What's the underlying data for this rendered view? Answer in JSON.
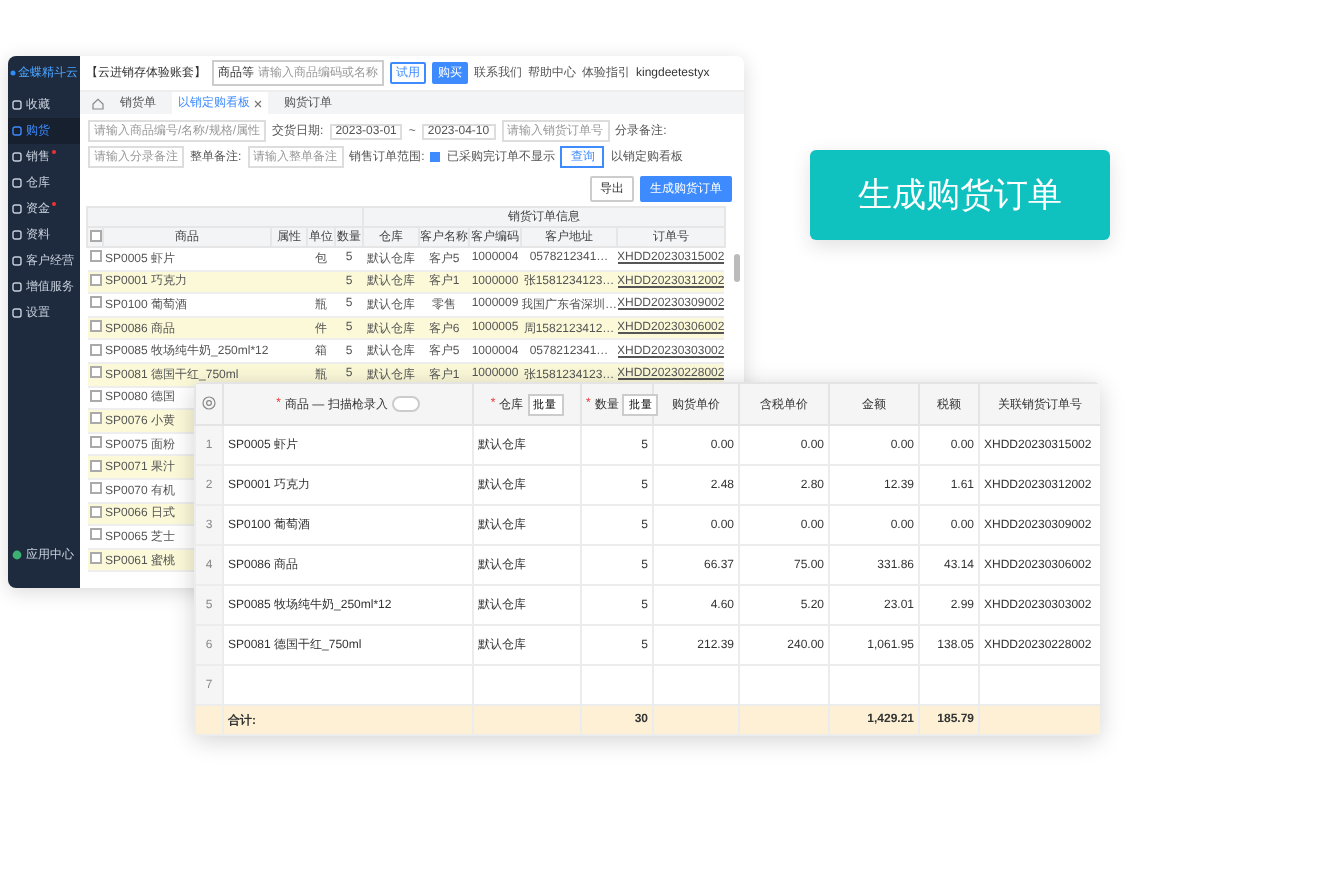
{
  "app_window": {
    "logo": "金蝶精斗云",
    "account_name": "【云进销存体验账套】",
    "search": {
      "scope": "商品等",
      "placeholder": "请输入商品编码或名称"
    },
    "header_buttons": [
      {
        "label": "试用",
        "kind": "outline"
      },
      {
        "label": "购买",
        "kind": "filled"
      }
    ],
    "header_links": [
      "联系我们",
      "帮助中心",
      "体验指引"
    ],
    "user": "kingdeetestyx",
    "sidebar": [
      {
        "label": "收藏",
        "selected": false,
        "badge": false
      },
      {
        "label": "购货",
        "selected": true,
        "badge": false
      },
      {
        "label": "销售",
        "selected": false,
        "badge": true
      },
      {
        "label": "仓库",
        "selected": false,
        "badge": false
      },
      {
        "label": "资金",
        "selected": false,
        "badge": true
      },
      {
        "label": "资料",
        "selected": false,
        "badge": false
      },
      {
        "label": "客户经营",
        "selected": false,
        "badge": false
      },
      {
        "label": "增值服务",
        "selected": false,
        "badge": false
      },
      {
        "label": "设置",
        "selected": false,
        "badge": false
      }
    ],
    "sidebar_footer": "应用中心",
    "tabs": [
      {
        "label": "销货单",
        "selected": false,
        "closable": false
      },
      {
        "label": "以销定购看板",
        "selected": true,
        "closable": true
      },
      {
        "label": "购货订单",
        "selected": false,
        "closable": false
      }
    ],
    "filters": {
      "product_placeholder": "请输入商品编号/名称/规格/属性",
      "date_label": "交货日期:",
      "date_from": "2023-03-01",
      "date_sep": "~",
      "date_to": "2023-04-10",
      "order_placeholder": "请输入销货订单号",
      "entry_note_label": "分录备注:",
      "entry_note_placeholder": "请输入分录备注",
      "note_label": "整单备注:",
      "note_placeholder": "请输入整单备注",
      "range_label": "销售订单范围:",
      "hide_done": {
        "label": "已采购完订单不显示",
        "checked": true
      },
      "query": "查询",
      "board": "以销定购看板"
    },
    "actions": [
      "导出",
      "生成购货订单"
    ],
    "table": {
      "group_header": "销货订单信息",
      "select_all_checked": false,
      "columns": [
        "商品",
        "属性",
        "单位",
        "数量",
        "仓库",
        "客户名称",
        "客户编码",
        "客户地址",
        "订单号"
      ],
      "rows": [
        {
          "cells": [
            "SP0005 虾片",
            "",
            "包",
            "5",
            "默认仓库",
            "客户5",
            "1000004",
            "0578212341…",
            "XHDD20230315002"
          ],
          "highlighted": false,
          "checked": false
        },
        {
          "cells": [
            "SP0001 巧克力",
            "",
            "",
            "5",
            "默认仓库",
            "客户1",
            "1000000",
            "张1581234123…",
            "XHDD20230312002"
          ],
          "highlighted": true,
          "checked": false
        },
        {
          "cells": [
            "SP0100 葡萄酒",
            "",
            "瓶",
            "5",
            "默认仓库",
            "零售",
            "1000009",
            "我国广东省深圳…",
            "XHDD20230309002"
          ],
          "highlighted": false,
          "checked": false
        },
        {
          "cells": [
            "SP0086 商品",
            "",
            "件",
            "5",
            "默认仓库",
            "客户6",
            "1000005",
            "周1582123412…",
            "XHDD20230306002"
          ],
          "highlighted": true,
          "checked": false
        },
        {
          "cells": [
            "SP0085 牧场纯牛奶_250ml*12",
            "",
            "箱",
            "5",
            "默认仓库",
            "客户5",
            "1000004",
            "0578212341…",
            "XHDD20230303002"
          ],
          "highlighted": false,
          "checked": false
        },
        {
          "cells": [
            "SP0081 德国干红_750ml",
            "",
            "瓶",
            "5",
            "默认仓库",
            "客户1",
            "1000000",
            "张1581234123…",
            "XHDD20230228002"
          ],
          "highlighted": true,
          "checked": false
        },
        {
          "cells": [
            "SP0080 德国"
          ],
          "highlighted": false,
          "checked": false
        },
        {
          "cells": [
            "SP0076 小黄"
          ],
          "highlighted": true,
          "checked": false
        },
        {
          "cells": [
            "SP0075 面粉"
          ],
          "highlighted": false,
          "checked": false
        },
        {
          "cells": [
            "SP0071 果汁"
          ],
          "highlighted": true,
          "checked": false
        },
        {
          "cells": [
            "SP0070 有机"
          ],
          "highlighted": false,
          "checked": false
        },
        {
          "cells": [
            "SP0066 日式"
          ],
          "highlighted": true,
          "checked": false
        },
        {
          "cells": [
            "SP0065 芝士"
          ],
          "highlighted": false,
          "checked": false
        },
        {
          "cells": [
            "SP0061 蜜桃"
          ],
          "highlighted": true,
          "checked": false
        }
      ]
    }
  },
  "banner": "生成购货订单",
  "order_table": {
    "columns": [
      {
        "label": "商品 — 扫描枪录入",
        "mark": "*",
        "kind": "toggle"
      },
      {
        "label": "仓库",
        "mark": "*",
        "kind": "batch",
        "action": "批量"
      },
      {
        "label": "数量",
        "mark": "*",
        "kind": "batch",
        "action": "批量"
      },
      {
        "label": "购货单价",
        "kind": "plain"
      },
      {
        "label": "含税单价",
        "kind": "plain"
      },
      {
        "label": "金额",
        "kind": "plain"
      },
      {
        "label": "税额",
        "kind": "plain"
      },
      {
        "label": "关联销货订单号",
        "kind": "plain"
      }
    ],
    "scan_mode_on": false,
    "rows": [
      {
        "index": "1",
        "cells": [
          "SP0005 虾片",
          "默认仓库",
          "5",
          "0.00",
          "0.00",
          "0.00",
          "0.00",
          "XHDD20230315002"
        ]
      },
      {
        "index": "2",
        "cells": [
          "SP0001 巧克力",
          "默认仓库",
          "5",
          "2.48",
          "2.80",
          "12.39",
          "1.61",
          "XHDD20230312002"
        ]
      },
      {
        "index": "3",
        "cells": [
          "SP0100 葡萄酒",
          "默认仓库",
          "5",
          "0.00",
          "0.00",
          "0.00",
          "0.00",
          "XHDD20230309002"
        ]
      },
      {
        "index": "4",
        "cells": [
          "SP0086 商品",
          "默认仓库",
          "5",
          "66.37",
          "75.00",
          "331.86",
          "43.14",
          "XHDD20230306002"
        ]
      },
      {
        "index": "5",
        "cells": [
          "SP0085 牧场纯牛奶_250ml*12",
          "默认仓库",
          "5",
          "4.60",
          "5.20",
          "23.01",
          "2.99",
          "XHDD20230303002"
        ]
      },
      {
        "index": "6",
        "cells": [
          "SP0081 德国干红_750ml",
          "默认仓库",
          "5",
          "212.39",
          "240.00",
          "1,061.95",
          "138.05",
          "XHDD20230228002"
        ]
      },
      {
        "index": "7",
        "cells": [
          "",
          "",
          "",
          "",
          "",
          "",
          "",
          ""
        ]
      }
    ],
    "total": {
      "label": "合计:",
      "cells": [
        "",
        "",
        "30",
        "",
        "",
        "1,429.21",
        "185.79",
        ""
      ]
    }
  }
}
